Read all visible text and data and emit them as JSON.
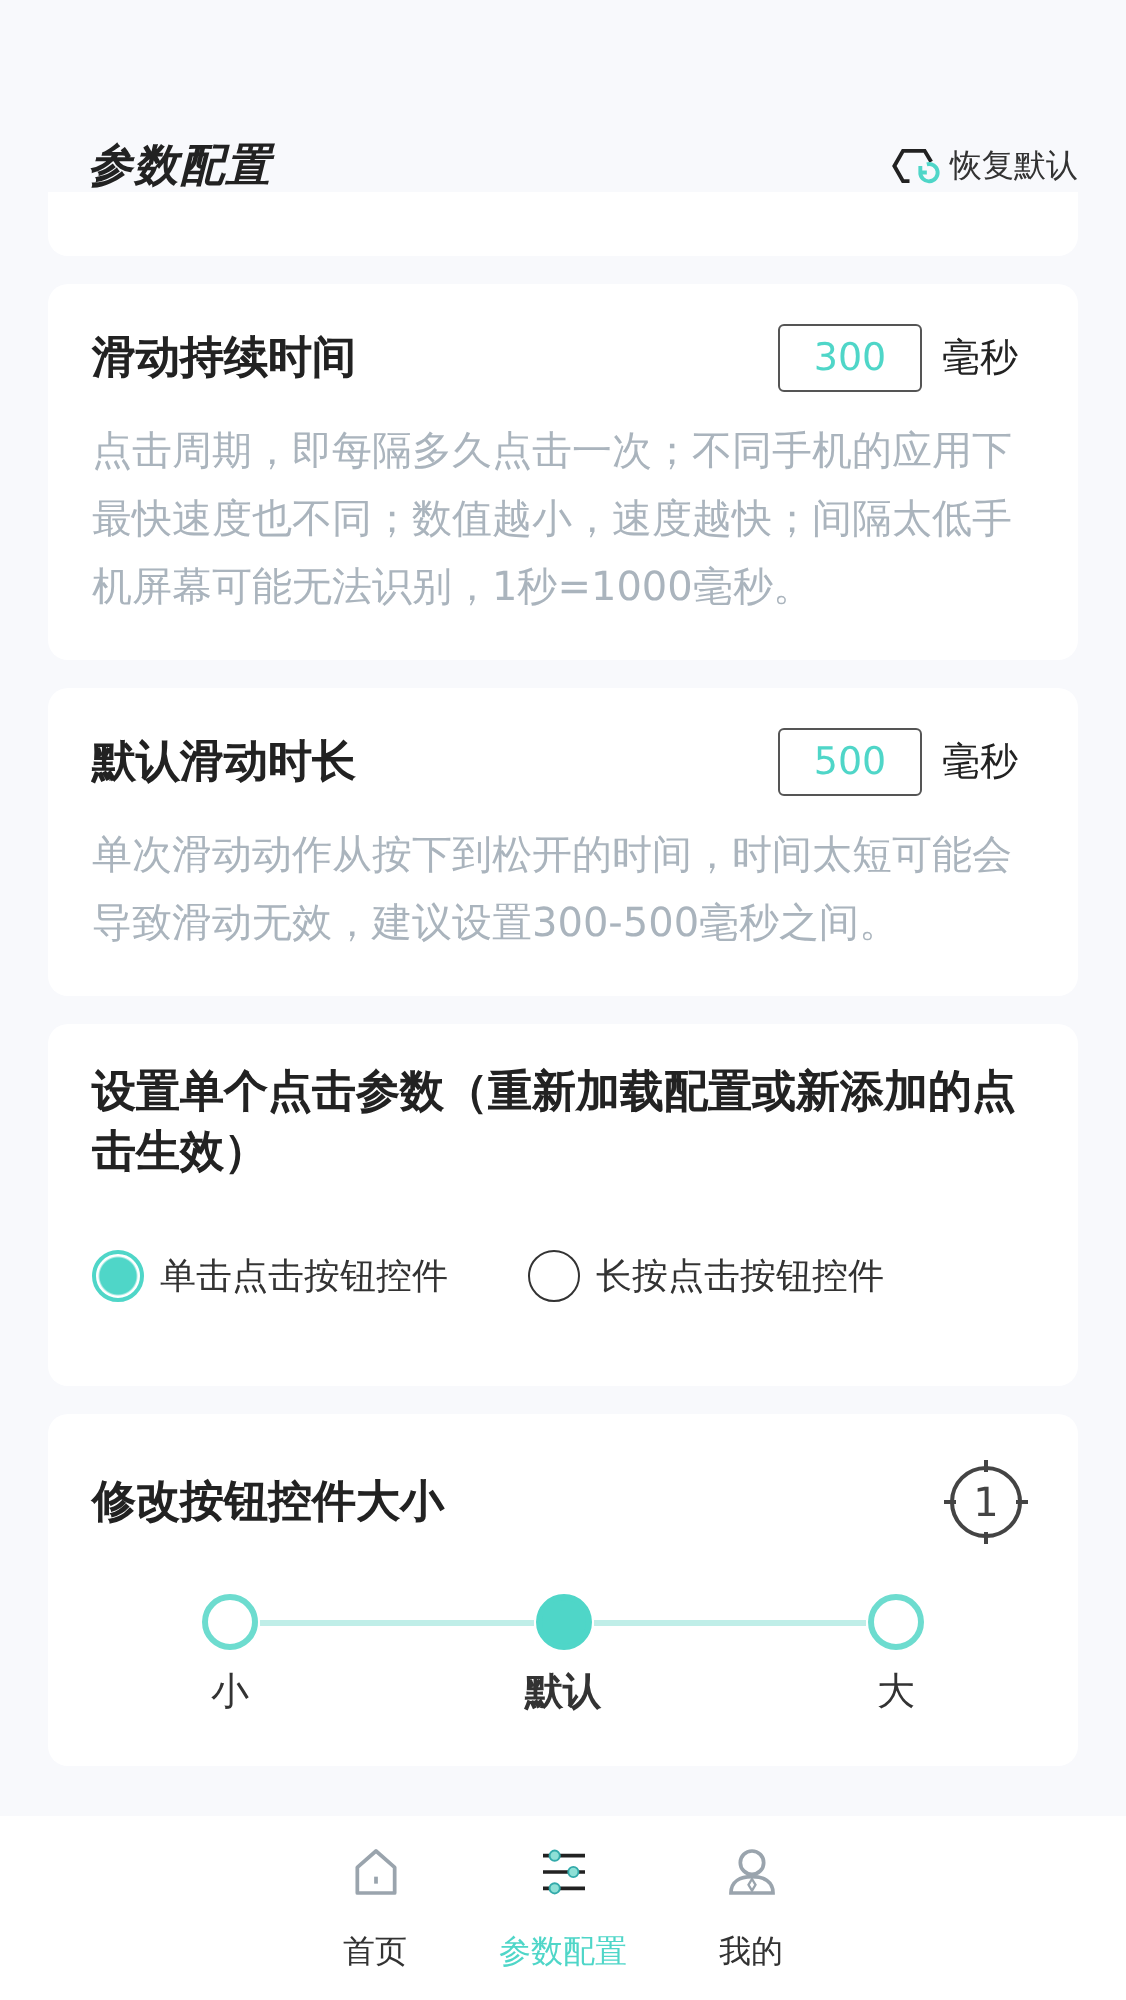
{
  "header": {
    "title": "参数配置",
    "restore_button": "恢复默认"
  },
  "settings": [
    {
      "kind": "number",
      "title": "滑动持续时间",
      "value": "300",
      "unit": "毫秒",
      "description": "点击周期，即每隔多久点击一次；不同手机的应用下最快速度也不同；数值越小，速度越快；间隔太低手机屏幕可能无法识别，1秒=1000毫秒。"
    },
    {
      "kind": "number",
      "title": "默认滑动时长",
      "value": "500",
      "unit": "毫秒",
      "description": "单次滑动动作从按下到松开的时间，时间太短可能会导致滑动无效，建议设置300-500毫秒之间。"
    },
    {
      "kind": "radio",
      "title": "设置单个点击参数（重新加载配置或新添加的点击生效）",
      "options": [
        {
          "label": "单击点击按钮控件",
          "selected": true
        },
        {
          "label": "长按点击按钮控件",
          "selected": false
        }
      ]
    },
    {
      "kind": "steps",
      "title": "修改按钮控件大小",
      "badge": "1",
      "options": [
        {
          "label": "小",
          "selected": false
        },
        {
          "label": "默认",
          "selected": true
        },
        {
          "label": "大",
          "selected": false
        }
      ]
    }
  ],
  "bottom_nav": [
    {
      "label": "首页",
      "kind": "home",
      "selected": false
    },
    {
      "label": "参数配置",
      "kind": "settings",
      "selected": true
    },
    {
      "label": "我的",
      "kind": "profile",
      "selected": false
    }
  ]
}
